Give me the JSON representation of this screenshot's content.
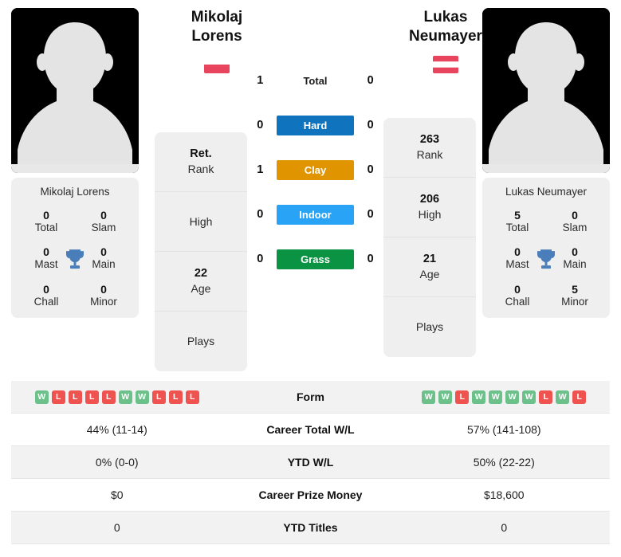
{
  "players": {
    "left": {
      "first_name": "Mikolaj",
      "last_name": "Lorens",
      "full_name": "Mikolaj Lorens",
      "flag_name": "poland-flag",
      "flag_colors": [
        "#ffffff",
        "#e8445e"
      ],
      "titles": {
        "total_value": "0",
        "total_label": "Total",
        "slam_value": "0",
        "slam_label": "Slam",
        "mast_value": "0",
        "mast_label": "Mast",
        "main_value": "0",
        "main_label": "Main",
        "chall_value": "0",
        "chall_label": "Chall",
        "minor_value": "0",
        "minor_label": "Minor"
      },
      "rank": {
        "rank_value": "Ret.",
        "rank_label": "Rank",
        "high_value": "",
        "high_label": "High",
        "age_value": "22",
        "age_label": "Age",
        "plays_value": "",
        "plays_label": "Plays"
      },
      "h2h": {
        "total": "1",
        "hard": "0",
        "clay": "1",
        "indoor": "0",
        "grass": "0"
      },
      "form": [
        "W",
        "L",
        "L",
        "L",
        "L",
        "W",
        "W",
        "L",
        "L",
        "L"
      ],
      "career_total_wl": "44% (11-14)",
      "ytd_wl": "0% (0-0)",
      "career_prize_money": "$0",
      "ytd_titles": "0"
    },
    "right": {
      "first_name": "Lukas",
      "last_name": "Neumayer",
      "full_name": "Lukas Neumayer",
      "flag_name": "austria-flag",
      "flag_colors": [
        "#e8445e",
        "#ffffff",
        "#e8445e"
      ],
      "titles": {
        "total_value": "5",
        "total_label": "Total",
        "slam_value": "0",
        "slam_label": "Slam",
        "mast_value": "0",
        "mast_label": "Mast",
        "main_value": "0",
        "main_label": "Main",
        "chall_value": "0",
        "chall_label": "Chall",
        "minor_value": "5",
        "minor_label": "Minor"
      },
      "rank": {
        "rank_value": "263",
        "rank_label": "Rank",
        "high_value": "206",
        "high_label": "High",
        "age_value": "21",
        "age_label": "Age",
        "plays_value": "",
        "plays_label": "Plays"
      },
      "h2h": {
        "total": "0",
        "hard": "0",
        "clay": "0",
        "indoor": "0",
        "grass": "0"
      },
      "form": [
        "W",
        "W",
        "L",
        "W",
        "W",
        "W",
        "W",
        "L",
        "W",
        "L"
      ],
      "career_total_wl": "57% (141-108)",
      "ytd_wl": "50% (22-22)",
      "career_prize_money": "$18,600",
      "ytd_titles": "0"
    }
  },
  "surfaces": [
    {
      "label": "Total",
      "color": "transparent",
      "plain": true
    },
    {
      "label": "Hard",
      "color": "#0f73bd",
      "plain": false
    },
    {
      "label": "Clay",
      "color": "#e09400",
      "plain": false
    },
    {
      "label": "Indoor",
      "color": "#28a3f5",
      "plain": false
    },
    {
      "label": "Grass",
      "color": "#0a9342",
      "plain": false
    }
  ],
  "table_rows": [
    {
      "label": "Form",
      "type": "form"
    },
    {
      "label": "Career Total W/L",
      "type": "text",
      "key": "career_total_wl"
    },
    {
      "label": "YTD W/L",
      "type": "text",
      "key": "ytd_wl"
    },
    {
      "label": "Career Prize Money",
      "type": "text",
      "key": "career_prize_money"
    },
    {
      "label": "YTD Titles",
      "type": "text",
      "key": "ytd_titles"
    }
  ],
  "icons": {
    "trophy": "trophy-icon",
    "avatar": "player-avatar-silhouette"
  },
  "colors": {
    "card_bg": "#efefef",
    "row_shaded": "#f2f2f2",
    "win_badge": "#6cc18a",
    "loss_badge": "#ef5350",
    "trophy": "#4a7ebb"
  }
}
